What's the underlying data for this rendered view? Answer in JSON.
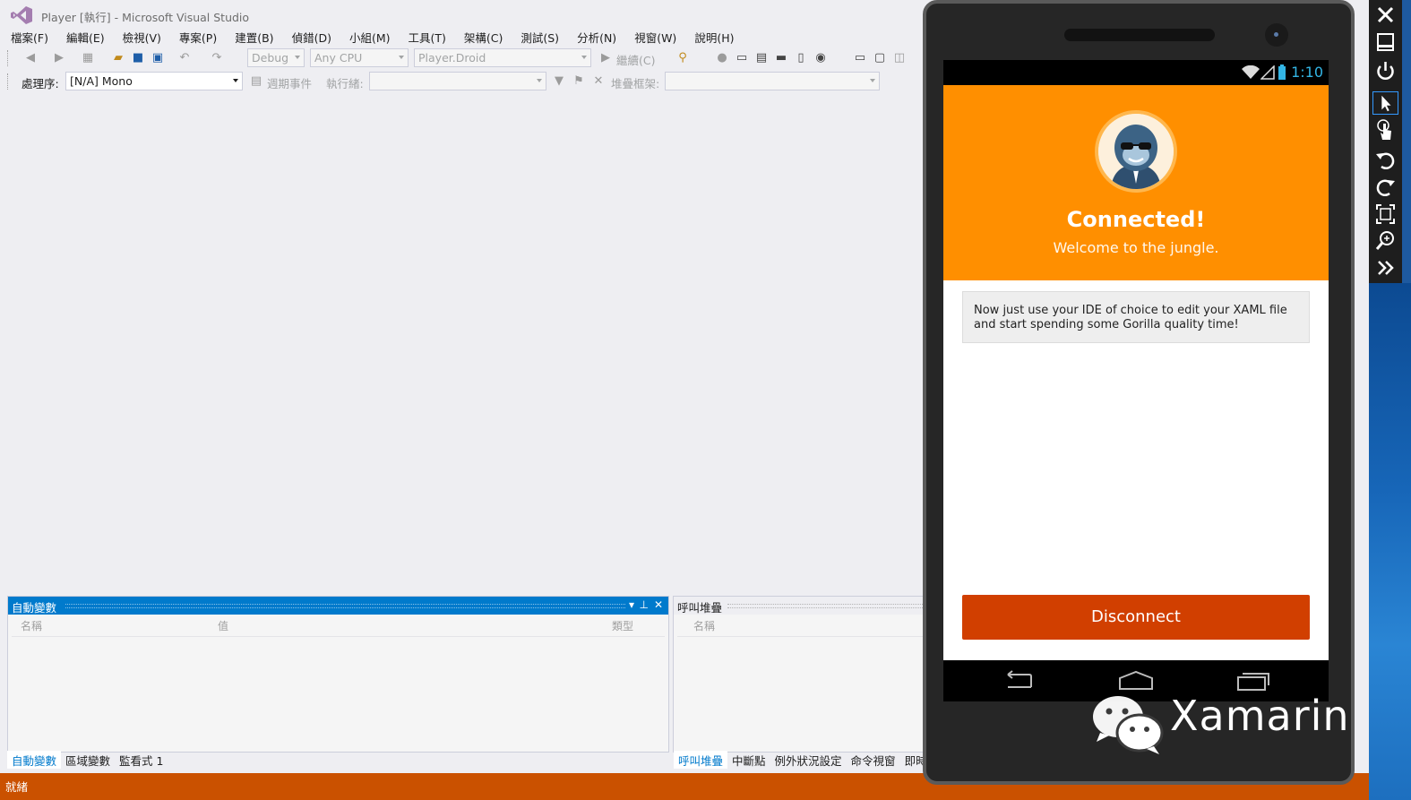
{
  "window": {
    "title": "Player [執行] - Microsoft Visual Studio"
  },
  "menu": [
    "檔案(F)",
    "編輯(E)",
    "檢視(V)",
    "專案(P)",
    "建置(B)",
    "偵錯(D)",
    "小組(M)",
    "工具(T)",
    "架構(C)",
    "測試(S)",
    "分析(N)",
    "視窗(W)",
    "說明(H)"
  ],
  "toolbar": {
    "configuration": "Debug",
    "platform": "Any CPU",
    "startup_project": "Player.Droid",
    "continue_label": "繼續(C)"
  },
  "debug_location": {
    "process_label": "處理序:",
    "process_value": "[N/A] Mono",
    "lifecycle_label": "週期事件",
    "thread_label": "執行緒:",
    "stack_label": "堆疊框架:"
  },
  "autos_panel": {
    "title": "自動變數",
    "columns": [
      "名稱",
      "值",
      "類型"
    ],
    "tabs": [
      "自動變數",
      "區域變數",
      "監看式 1"
    ]
  },
  "callstack_panel": {
    "title": "呼叫堆疊",
    "columns": [
      "名稱"
    ],
    "tabs": [
      "呼叫堆疊",
      "中斷點",
      "例外狀況設定",
      "命令視窗",
      "即時運"
    ]
  },
  "status": {
    "text": "就緒"
  },
  "device": {
    "clock": "1:10",
    "hero_title": "Connected!",
    "hero_subtitle": "Welcome to the jungle.",
    "card_text": "Now just use your IDE of choice to edit your XAML file and start spending some Gorilla quality time!",
    "disconnect_label": "Disconnect"
  },
  "watermark": {
    "text": "Xamarin"
  },
  "colors": {
    "vs_accent": "#007acc",
    "status_bar": "#ca5100",
    "hero_orange": "#ff8f00",
    "disconnect_red": "#d13f00",
    "android_blue": "#33b5e5"
  },
  "icons": {
    "sidebar": [
      "close-icon",
      "minimize-icon",
      "power-icon",
      "pointer-icon",
      "touch-icon",
      "rotate-left-icon",
      "rotate-right-icon",
      "fit-screen-icon",
      "zoom-icon",
      "more-icon"
    ],
    "nav": [
      "back-icon",
      "home-icon",
      "recents-icon"
    ]
  }
}
